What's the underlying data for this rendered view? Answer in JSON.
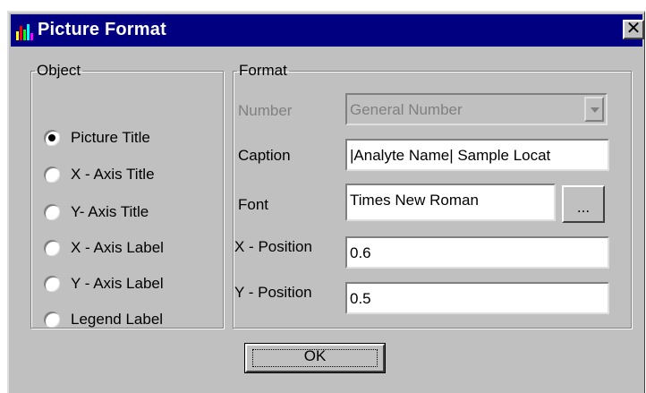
{
  "window": {
    "title": "Picture Format",
    "close_symbol": "✕",
    "icon": "chart-icon"
  },
  "object_group": {
    "legend": "Object",
    "options": [
      {
        "label": "Picture Title",
        "checked": true
      },
      {
        "label": "X - Axis Title",
        "checked": false
      },
      {
        "label": "Y- Axis Title",
        "checked": false
      },
      {
        "label": "X - Axis Label",
        "checked": false
      },
      {
        "label": "Y - Axis Label",
        "checked": false
      },
      {
        "label": "Legend Label",
        "checked": false
      }
    ]
  },
  "format_group": {
    "legend": "Format",
    "number": {
      "label": "Number",
      "value": "General Number"
    },
    "caption": {
      "label": "Caption",
      "value": "|Analyte Name| Sample Locat"
    },
    "font": {
      "label": "Font",
      "value": "Times New Roman",
      "browse_label": "..."
    },
    "x_position": {
      "label": "X - Position",
      "value": "0.6"
    },
    "y_position": {
      "label": "Y - Position",
      "value": "0.5"
    }
  },
  "buttons": {
    "ok_label": "OK"
  },
  "colors": {
    "titlebar": "#000080",
    "face": "#c0c0c0"
  }
}
